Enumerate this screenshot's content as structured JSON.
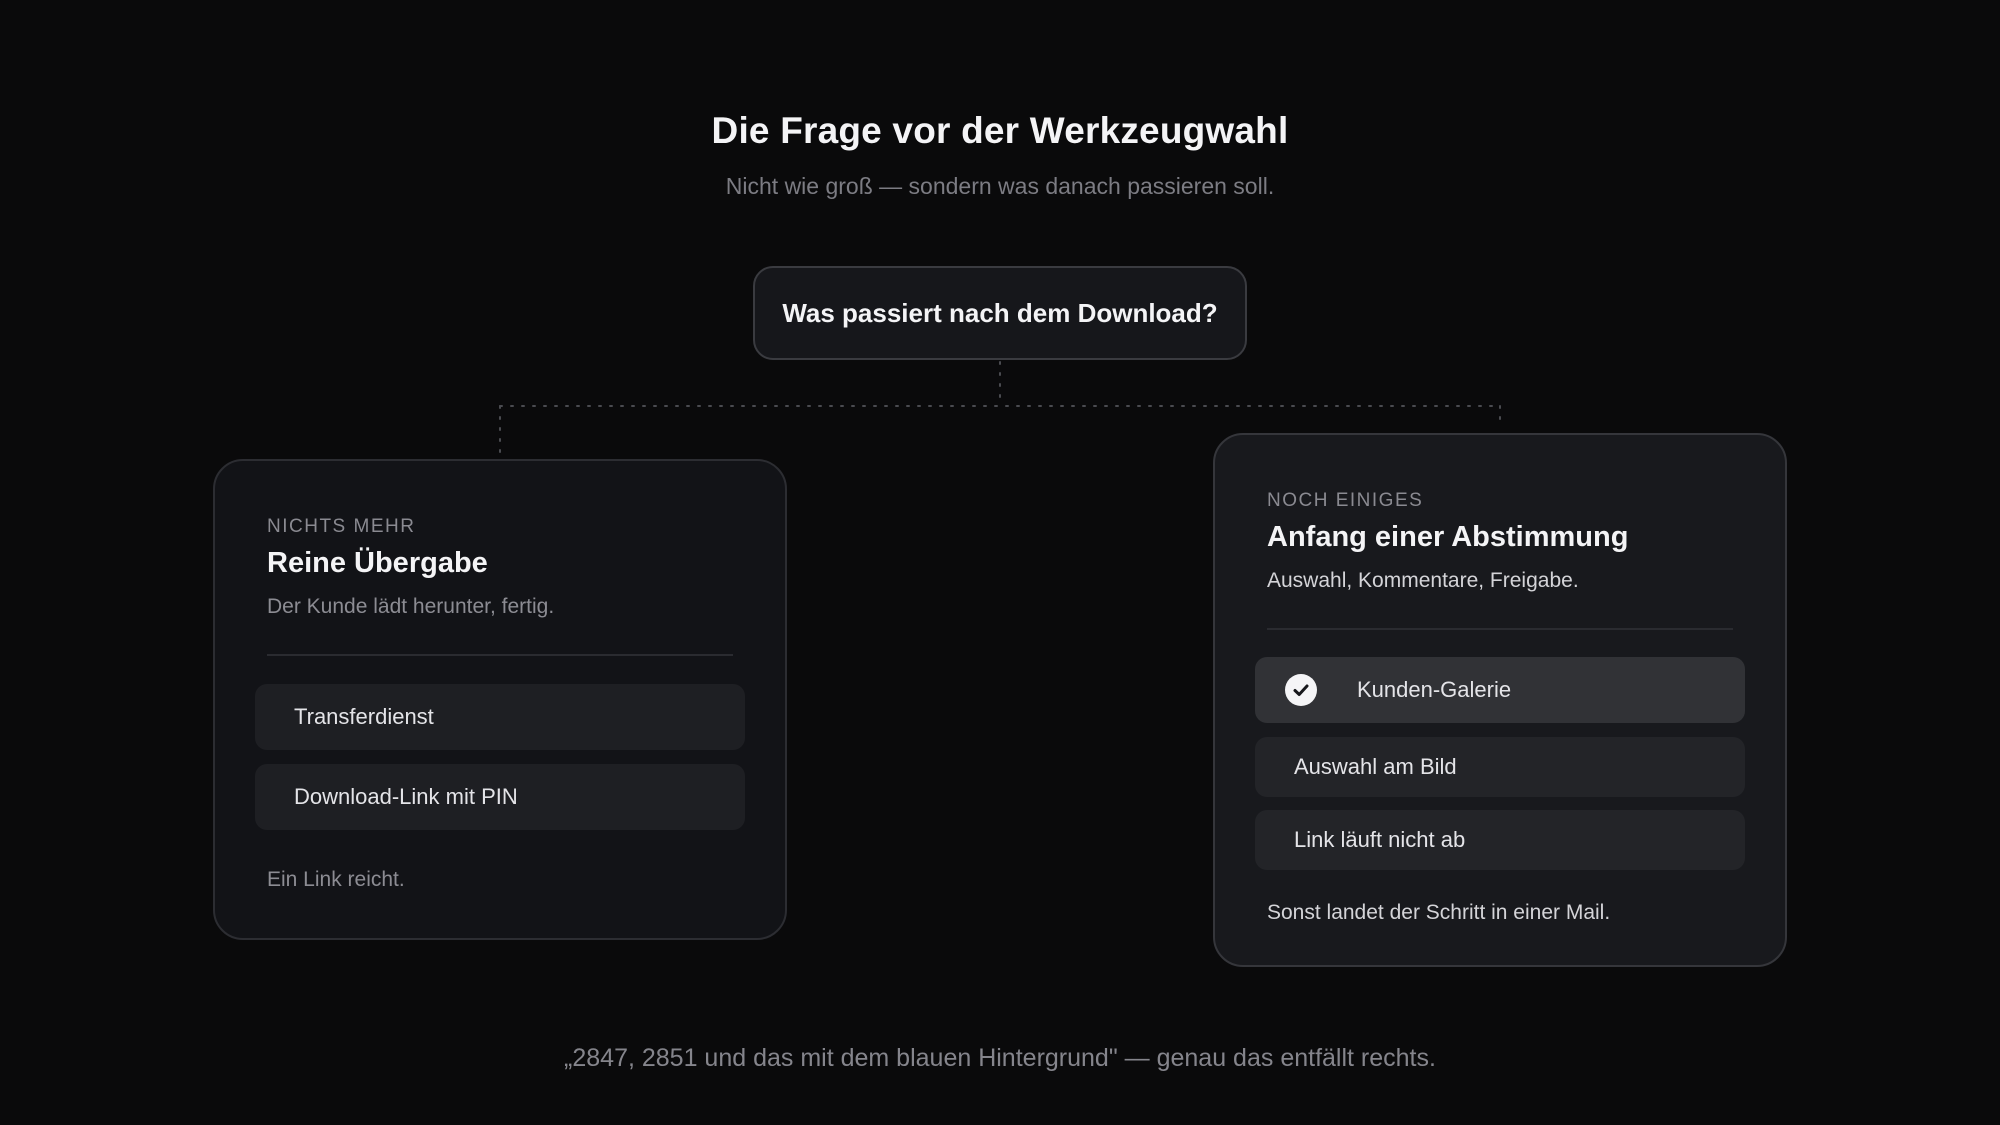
{
  "header": {
    "title": "Die Frage vor der Werkzeugwahl",
    "subtitle": "Nicht wie groß — sondern was danach passieren soll."
  },
  "question": "Was passiert nach dem Download?",
  "left_card": {
    "eyebrow": "NICHTS MEHR",
    "title": "Reine Übergabe",
    "description": "Der Kunde lädt herunter, fertig.",
    "options": [
      "Transferdienst",
      "Download-Link mit PIN"
    ],
    "footnote": "Ein Link reicht."
  },
  "right_card": {
    "eyebrow": "NOCH EINIGES",
    "title": "Anfang einer Abstimmung",
    "description": "Auswahl, Kommentare, Freigabe.",
    "options": [
      {
        "label": "Kunden-Galerie",
        "selected": true,
        "icon": "check-circle-icon"
      },
      {
        "label": "Auswahl am Bild",
        "selected": false
      },
      {
        "label": "Link läuft nicht ab",
        "selected": false
      }
    ],
    "footnote": "Sonst landet der Schritt in einer Mail."
  },
  "quote": "„2847, 2851 und das mit dem blauen Hintergrund\" — genau das entfällt rechts.",
  "colors": {
    "background": "#0a0a0b",
    "card": "#121317",
    "card_highlight": "#18191d",
    "connector": "#4a4b50"
  }
}
